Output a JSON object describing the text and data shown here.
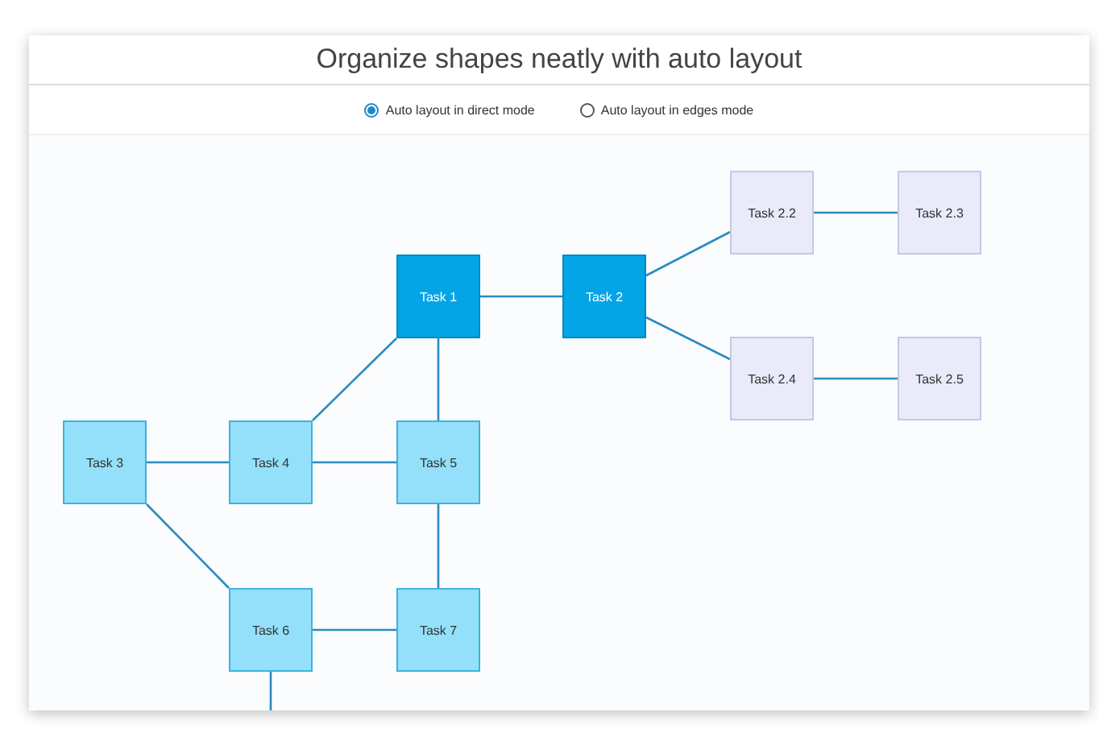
{
  "title": "Organize shapes neatly with auto layout",
  "layout_modes": [
    {
      "label": "Auto layout in direct mode",
      "selected": true
    },
    {
      "label": "Auto layout in edges mode",
      "selected": false
    }
  ],
  "nodes": [
    {
      "label": "Task 2.2",
      "kind": "leaf"
    },
    {
      "label": "Task 2.3",
      "kind": "leaf"
    },
    {
      "label": "Task 1",
      "kind": "primary"
    },
    {
      "label": "Task 2",
      "kind": "primary"
    },
    {
      "label": "Task 2.4",
      "kind": "leaf"
    },
    {
      "label": "Task 2.5",
      "kind": "leaf"
    },
    {
      "label": "Task 3",
      "kind": "child"
    },
    {
      "label": "Task 4",
      "kind": "child"
    },
    {
      "label": "Task 5",
      "kind": "child"
    },
    {
      "label": "Task 6",
      "kind": "child"
    },
    {
      "label": "Task 7",
      "kind": "child"
    }
  ]
}
